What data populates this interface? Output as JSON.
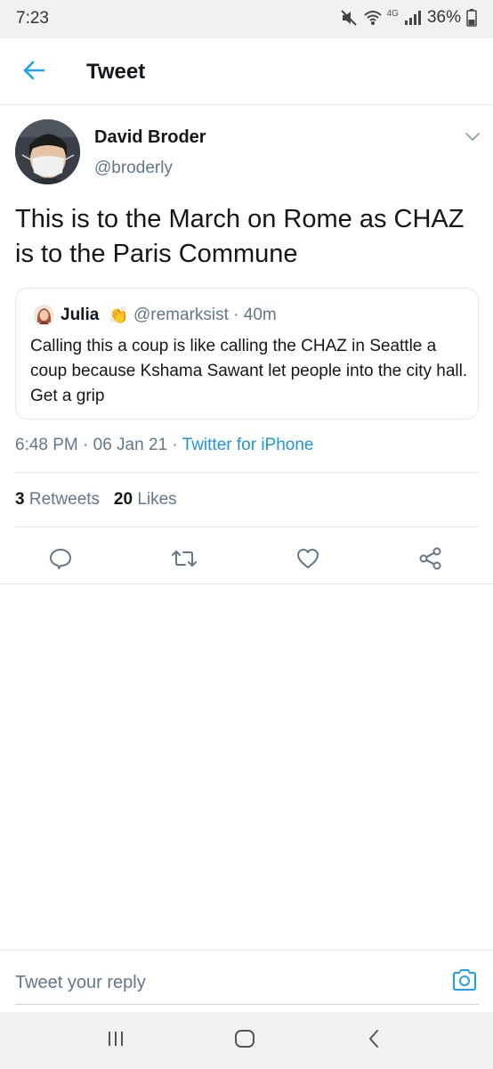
{
  "status_bar": {
    "time": "7:23",
    "network": "4G",
    "battery": "36%",
    "icons": [
      "mute-icon",
      "wifi-icon",
      "signal-icon",
      "battery-icon"
    ]
  },
  "header": {
    "title": "Tweet",
    "back_icon": "back-arrow-icon"
  },
  "tweet": {
    "author_name": "David Broder",
    "author_handle": "@broderly",
    "text": "This is to the March on Rome as CHAZ is to the Paris Commune",
    "timestamp": "6:48 PM · 06 Jan 21",
    "separator": " · ",
    "source": "Twitter for iPhone",
    "retweets_count": "3",
    "retweets_label": " Retweets",
    "likes_count": "20",
    "likes_label": " Likes"
  },
  "quote": {
    "name": "Julia",
    "badge_emoji": "👏",
    "handle_time": "@remarksist · 40m",
    "text": "Calling this a coup is like calling the CHAZ in Seattle a coup because Kshama Sawant let people into the city hall. Get a grip"
  },
  "actions": [
    "reply-icon",
    "retweet-icon",
    "like-icon",
    "share-icon"
  ],
  "reply_bar": {
    "placeholder": "Tweet your reply"
  },
  "nav_bar": [
    "recents-icon",
    "home-icon",
    "back-icon"
  ],
  "colors": {
    "accent": "#1da1f2",
    "link": "#1b95e0",
    "secondary_text": "#657786",
    "border": "#e1e8ed",
    "system_bar": "#f1f1f1"
  }
}
